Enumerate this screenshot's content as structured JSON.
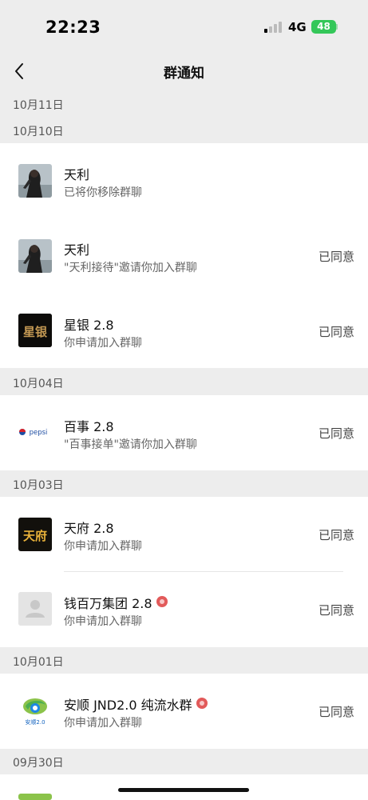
{
  "status_bar": {
    "time": "22:23",
    "network": "4G",
    "battery": "48"
  },
  "nav": {
    "title": "群通知"
  },
  "sections": [
    {
      "date": "10月11日",
      "items": []
    },
    {
      "date": "10月10日",
      "items": [
        {
          "title": "天利",
          "subtitle": "已将你移除群聊",
          "status": ""
        },
        {
          "title": "天利",
          "subtitle": "\"天利接待\"邀请你加入群聊",
          "status": "已同意"
        },
        {
          "title": "星银 2.8",
          "subtitle": "你申请加入群聊",
          "status": "已同意",
          "avatar_text": "星银"
        }
      ]
    },
    {
      "date": "10月04日",
      "items": [
        {
          "title": "百事 2.8",
          "subtitle": "\"百事接单\"邀请你加入群聊",
          "status": "已同意",
          "avatar_text": "pepsi"
        }
      ]
    },
    {
      "date": "10月03日",
      "items": [
        {
          "title": "天府 2.8",
          "subtitle": "你申请加入群聊",
          "status": "已同意",
          "avatar_text": "天府"
        },
        {
          "title": "钱百万集团 2.8",
          "subtitle": "你申请加入群聊",
          "status": "已同意"
        }
      ]
    },
    {
      "date": "10月01日",
      "items": [
        {
          "title": "安顺 JND2.0 纯流水群",
          "subtitle": "你申请加入群聊",
          "status": "已同意",
          "avatar_text": "安顺2.0"
        }
      ]
    },
    {
      "date": "09月30日",
      "items": []
    }
  ]
}
